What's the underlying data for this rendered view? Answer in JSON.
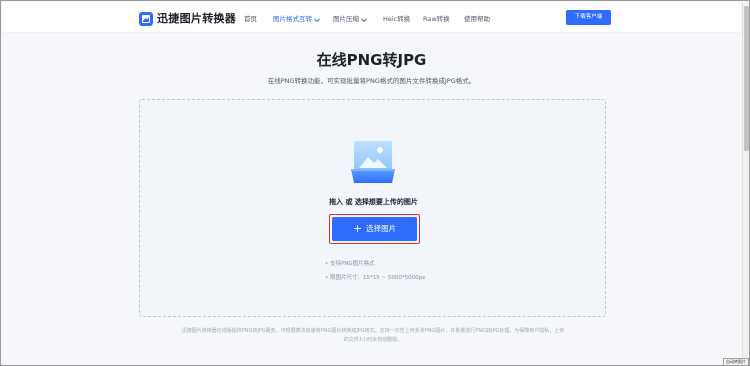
{
  "header": {
    "logo_text": "迅捷图片转换器",
    "nav": [
      {
        "label": "首页"
      },
      {
        "label": "图片格式互转"
      },
      {
        "label": "图片压缩"
      },
      {
        "label": "Heic转换"
      },
      {
        "label": "Raw转换"
      },
      {
        "label": "使用帮助"
      }
    ],
    "download_label": "下载客户端"
  },
  "main": {
    "title": "在线PNG转JPG",
    "subtitle": "在线PNG转换功能，可实现批量将PNG格式的图片文件转换成JPG格式。"
  },
  "dropzone": {
    "prompt": "拖入 或 选择想要上传的图片",
    "button_label": "选择图片",
    "hints": [
      "• 支持PNG图片格式",
      "• 限图片尺寸：15*15 ~ 5000*5000px"
    ]
  },
  "footer": {
    "line1": "迅捷图片转换器在线版提供PNG转JPG服务，可根据算法快速将PNG图片转换成JPG格式。支持一次性上传多张PNG图片，并批量进行PNG转JPG处理。为保障用户隐私，上传",
    "line2": "的文件1小时会自动删除。"
  },
  "corner_button": "自动转图片",
  "colors": {
    "accent": "#2f6bff",
    "highlight_border": "#e03131",
    "page_bg": "#f5f7fa"
  },
  "icons": [
    "logo-icon",
    "chevron-down-icon",
    "image-upload-icon",
    "plus-icon"
  ]
}
